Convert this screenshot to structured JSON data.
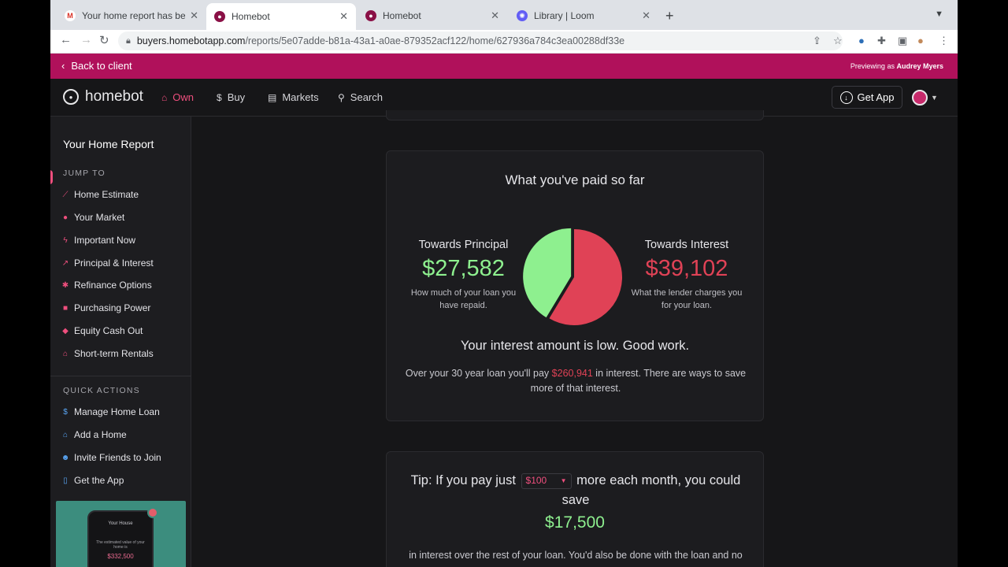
{
  "browser": {
    "tabs": [
      {
        "label": "Your home report has been up",
        "favicon": "gmail-icon"
      },
      {
        "label": "Homebot",
        "favicon": "homebot-icon"
      },
      {
        "label": "Homebot",
        "favicon": "homebot-icon"
      },
      {
        "label": "Library | Loom",
        "favicon": "loom-icon"
      }
    ],
    "url_host": "buyers.homebotapp.com",
    "url_path": "/reports/5e07adde-b81a-43a1-a0ae-879352acf122/home/627936a784c3ea00288df33e"
  },
  "banner": {
    "back_label": "Back to client",
    "preview_prefix": "Previewing as",
    "preview_name": "Audrey Myers",
    "color": "#b0115b"
  },
  "header": {
    "brand": "homebot",
    "nav": [
      {
        "label": "Own",
        "icon": "home-icon"
      },
      {
        "label": "Buy",
        "icon": "dollar-circle-icon"
      },
      {
        "label": "Markets",
        "icon": "markets-icon"
      },
      {
        "label": "Search",
        "icon": "search-icon"
      }
    ],
    "get_app_label": "Get App",
    "accent": "#ef4f7e"
  },
  "sidebar": {
    "title": "Your Home Report",
    "jump_heading": "JUMP TO",
    "jump_items": [
      {
        "label": "Home Estimate",
        "icon": "chart-line-icon"
      },
      {
        "label": "Your Market",
        "icon": "map-pin-icon"
      },
      {
        "label": "Important Now",
        "icon": "lightning-icon"
      },
      {
        "label": "Principal & Interest",
        "icon": "trend-icon"
      },
      {
        "label": "Refinance Options",
        "icon": "refinance-icon"
      },
      {
        "label": "Purchasing Power",
        "icon": "wallet-icon"
      },
      {
        "label": "Equity Cash Out",
        "icon": "piggy-bank-icon"
      },
      {
        "label": "Short-term Rentals",
        "icon": "rental-home-icon"
      }
    ],
    "actions_heading": "QUICK ACTIONS",
    "action_items": [
      {
        "label": "Manage Home Loan",
        "icon": "dollar-icon"
      },
      {
        "label": "Add a Home",
        "icon": "add-home-icon"
      },
      {
        "label": "Invite Friends to Join",
        "icon": "friends-icon"
      },
      {
        "label": "Get the App",
        "icon": "phone-icon"
      }
    ],
    "promo": {
      "title": "Your House",
      "desc": "The estimated value of your home is",
      "value": "$332,500"
    }
  },
  "paid_card": {
    "title": "What you've paid so far",
    "principal": {
      "label": "Towards Principal",
      "amount": "$27,582",
      "desc": "How much of your loan you have repaid."
    },
    "interest": {
      "label": "Towards Interest",
      "amount": "$39,102",
      "desc": "What the lender charges you for your loan."
    },
    "pie": {
      "principal_value": 27582,
      "interest_value": 39102,
      "principal_color": "#8ef08f",
      "interest_color": "#e04256"
    },
    "message": "Your interest amount is low. Good work.",
    "sub_before": "Over your 30 year loan you'll pay",
    "sub_value": "$260,941",
    "sub_after": "in interest. There are ways to save more of that interest."
  },
  "tip_card": {
    "tip_before": "Tip: If you pay just",
    "select_value": "$100",
    "tip_after": "more each month, you could save",
    "save_amount": "$17,500",
    "sub": "in interest over the rest of your loan. You'd also be done with the loan and no"
  }
}
